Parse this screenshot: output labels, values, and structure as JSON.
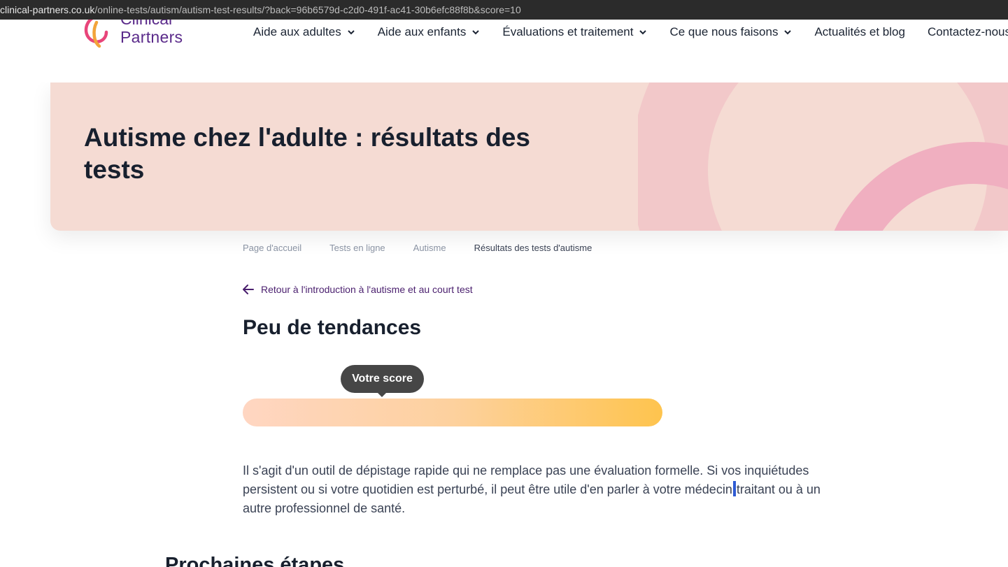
{
  "browser": {
    "url_host": "clinical-partners.co.uk",
    "url_path": "/online-tests/autism/autism-test-results/?back=96b6579d-c2d0-491f-ac41-30b6efc88f8b&score=10"
  },
  "header": {
    "logo_top": "Clinical",
    "logo_bottom": "Partners",
    "nav": [
      {
        "label": "Aide aux adultes",
        "has_dropdown": true
      },
      {
        "label": "Aide aux enfants",
        "has_dropdown": true
      },
      {
        "label": "Évaluations et traitement",
        "has_dropdown": true
      },
      {
        "label": "Ce que nous faisons",
        "has_dropdown": true
      },
      {
        "label": "Actualités et blog",
        "has_dropdown": false
      },
      {
        "label": "Contactez-nous",
        "has_dropdown": false
      }
    ]
  },
  "hero": {
    "title": "Autisme chez l'adulte : résultats des tests",
    "background": "#f5dbd3",
    "accent": "#f0afc0"
  },
  "breadcrumb": [
    "Page d'accueil",
    "Tests en ligne",
    "Autisme",
    "Résultats des tests d'autisme"
  ],
  "back_link": "Retour à l'introduction à l'autisme et au court test",
  "result": {
    "title": "Peu de tendances",
    "tooltip": "Votre score",
    "score_position_fraction": 0.33
  },
  "body": {
    "part1": "Il s'agit d'un outil de dépistage rapide qui ne remplace pas une évaluation formelle. Si vos inquiétudes persistent ou si votre quotidien est perturbé, il peut être utile d'en parler à votre médecin",
    "part2": "traitant ou à un autre professionnel de santé."
  },
  "next_steps_title": "Prochaines étapes"
}
